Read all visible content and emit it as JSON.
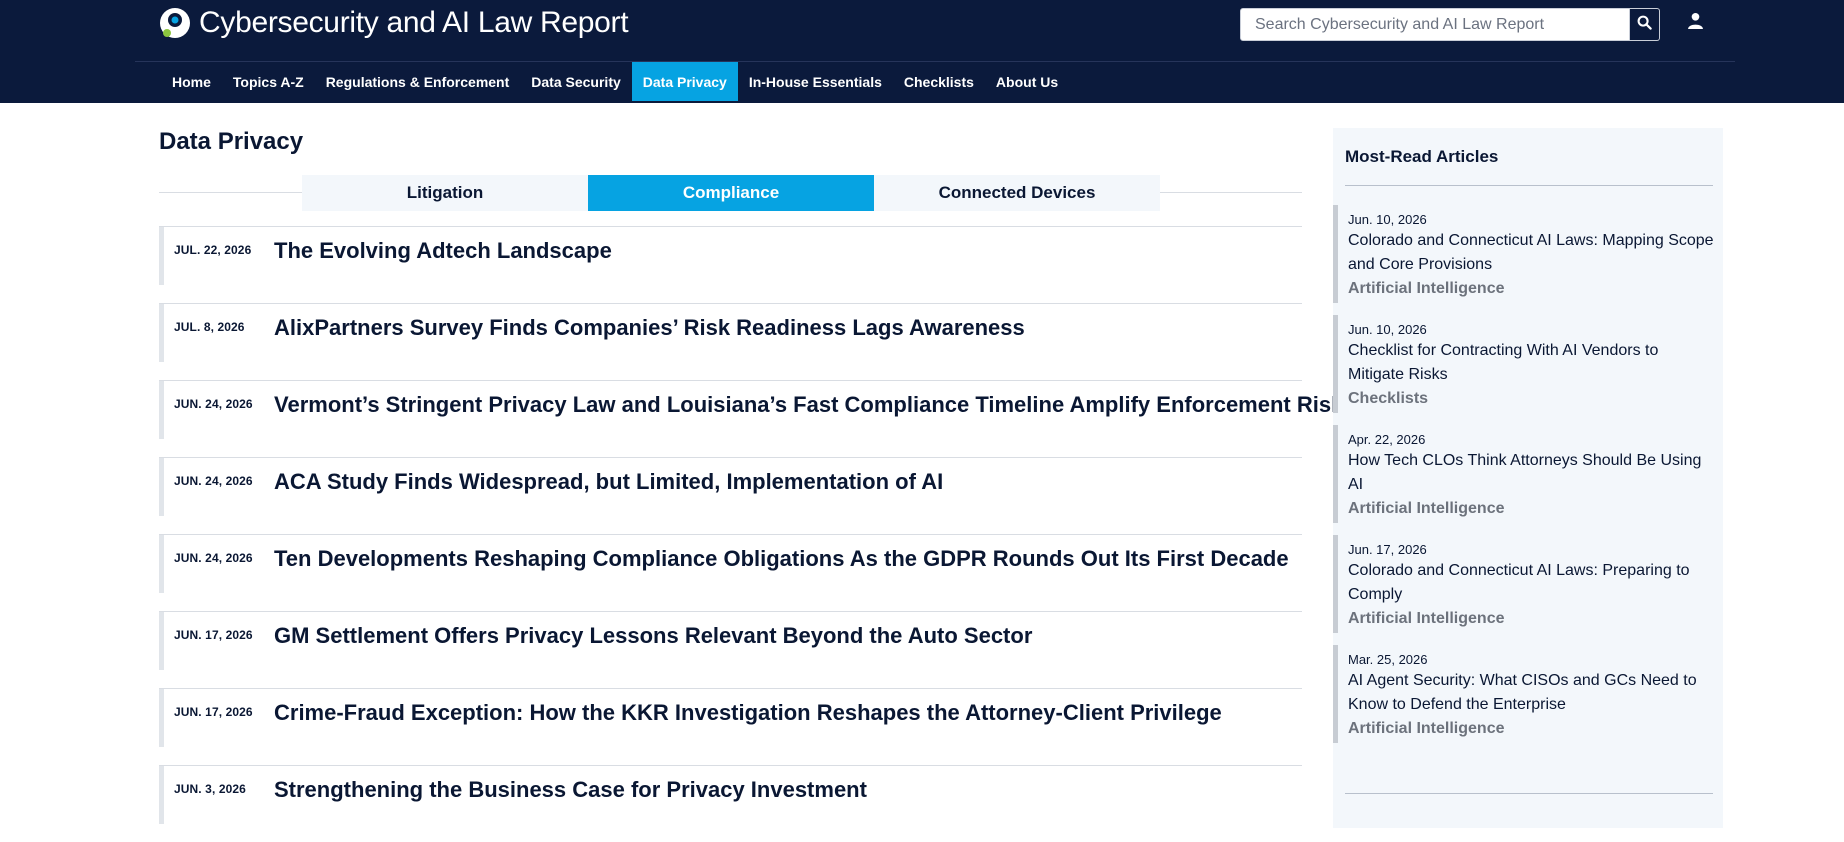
{
  "header": {
    "site_title": "Cybersecurity and AI Law Report",
    "search_placeholder": "Search Cybersecurity and AI Law Report",
    "search_icon": "search-icon",
    "user_icon": "user-icon",
    "logo_icon": "logo-mark-icon"
  },
  "nav": {
    "items": [
      {
        "label": "Home"
      },
      {
        "label": "Topics A-Z"
      },
      {
        "label": "Regulations & Enforcement"
      },
      {
        "label": "Data Security"
      },
      {
        "label": "Data Privacy",
        "active": true
      },
      {
        "label": "In-House Essentials"
      },
      {
        "label": "Checklists"
      },
      {
        "label": "About Us"
      }
    ]
  },
  "main": {
    "page_title": "Data Privacy",
    "tabs": [
      {
        "label": "Litigation"
      },
      {
        "label": "Compliance",
        "active": true
      },
      {
        "label": "Connected Devices"
      }
    ],
    "articles": [
      {
        "date": "JUL. 22, 2026",
        "title": "The Evolving Adtech Landscape"
      },
      {
        "date": "JUL. 8, 2026",
        "title": "AlixPartners Survey Finds Companies’ Risk Readiness Lags Awareness"
      },
      {
        "date": "JUN. 24, 2026",
        "title": "Vermont’s Stringent Privacy Law and Louisiana’s Fast Compliance Timeline Amplify Enforcement Risk"
      },
      {
        "date": "JUN. 24, 2026",
        "title": "ACA Study Finds Widespread, but Limited, Implementation of AI"
      },
      {
        "date": "JUN. 24, 2026",
        "title": "Ten Developments Reshaping Compliance Obligations As the GDPR Rounds Out Its First Decade"
      },
      {
        "date": "JUN. 17, 2026",
        "title": "GM Settlement Offers Privacy Lessons Relevant Beyond the Auto Sector"
      },
      {
        "date": "JUN. 17, 2026",
        "title": "Crime-Fraud Exception: How the KKR Investigation Reshapes the Attorney-Client Privilege"
      },
      {
        "date": "JUN. 3, 2026",
        "title": "Strengthening the Business Case for Privacy Investment"
      }
    ]
  },
  "sidebar": {
    "title": "Most-Read Articles",
    "items": [
      {
        "date": "Jun. 10, 2026",
        "title": "Colorado and Connecticut AI Laws: Mapping Scope and Core Provisions",
        "topic": "Artificial Intelligence"
      },
      {
        "date": "Jun. 10, 2026",
        "title": "Checklist for Contracting With AI Vendors to Mitigate Risks",
        "topic": "Checklists"
      },
      {
        "date": "Apr. 22, 2026",
        "title": "How Tech CLOs Think Attorneys Should Be Using AI",
        "topic": "Artificial Intelligence"
      },
      {
        "date": "Jun. 17, 2026",
        "title": "Colorado and Connecticut AI Laws: Preparing to Comply",
        "topic": "Artificial Intelligence"
      },
      {
        "date": "Mar. 25, 2026",
        "title": "AI Agent Security: What CISOs and GCs Need to Know to Defend the Enterprise",
        "topic": "Artificial Intelligence"
      }
    ]
  },
  "colors": {
    "header_bg": "#0b1a3c",
    "accent": "#06a3e2",
    "text": "#0a1733",
    "sidebar_bg": "#f3f7fb"
  }
}
